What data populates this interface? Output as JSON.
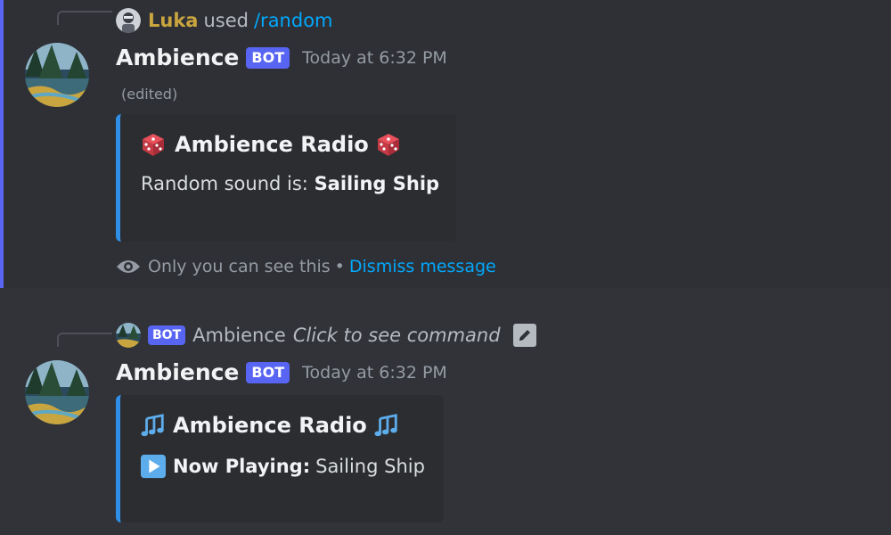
{
  "message1": {
    "reply": {
      "user": "Luka",
      "used": "used",
      "command": "/random"
    },
    "author": "Ambience",
    "bot_tag": "BOT",
    "timestamp": "Today at 6:32 PM",
    "edited": "(edited)",
    "embed": {
      "title": "Ambience Radio",
      "title_emoji": "game-die",
      "desc_prefix": "Random sound is: ",
      "desc_value": "Sailing Ship",
      "accent_color": "#2f8fe6"
    },
    "ephemeral": {
      "icon": "eye-icon",
      "text": "Only you can see this",
      "separator": "•",
      "dismiss": "Dismiss message"
    }
  },
  "message2": {
    "reply": {
      "bot_tag": "BOT",
      "name": "Ambience",
      "click_text": "Click to see command"
    },
    "author": "Ambience",
    "bot_tag": "BOT",
    "timestamp": "Today at 6:32 PM",
    "embed": {
      "title": "Ambience Radio",
      "title_emoji": "musical-notes",
      "now_playing_label": "Now Playing:",
      "now_playing_value": "Sailing Ship",
      "accent_color": "#2f8fe6"
    }
  },
  "colors": {
    "bot_tag": "#5865f2",
    "link": "#00a8fc",
    "highlight_bar": "#5865f2",
    "reply_user": "#c9a53f"
  }
}
